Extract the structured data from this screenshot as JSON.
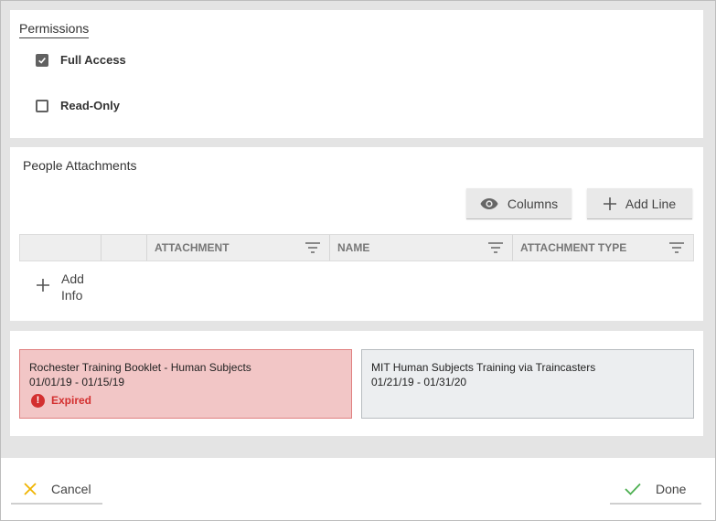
{
  "permissions": {
    "title": "Permissions",
    "options": [
      {
        "label": "Full Access",
        "checked": true
      },
      {
        "label": "Read-Only",
        "checked": false
      }
    ]
  },
  "people_attachments": {
    "title": "People Attachments",
    "columns_button": {
      "label": "Columns",
      "icon": "eye-icon"
    },
    "add_line_button": {
      "label": "Add Line",
      "icon": "plus-icon"
    },
    "table_headers": [
      "",
      "",
      "ATTACHMENT",
      "NAME",
      "ATTACHMENT TYPE"
    ],
    "add_info": {
      "label": "Add Info",
      "icon": "plus-icon"
    }
  },
  "trainings": [
    {
      "title": "Rochester Training Booklet - Human Subjects",
      "dates": "01/01/19 - 01/15/19",
      "status": "Expired",
      "status_color": "#d32f2f",
      "background": "#f2c6c6"
    },
    {
      "title": "MIT Human Subjects Training via Traincasters",
      "dates": "01/21/19 - 01/31/20",
      "background": "#eceef0"
    }
  ],
  "footer": {
    "cancel": {
      "label": "Cancel",
      "icon": "close-icon",
      "icon_color": "#f0b400"
    },
    "done": {
      "label": "Done",
      "icon": "check-icon",
      "icon_color": "#4caf50"
    }
  }
}
